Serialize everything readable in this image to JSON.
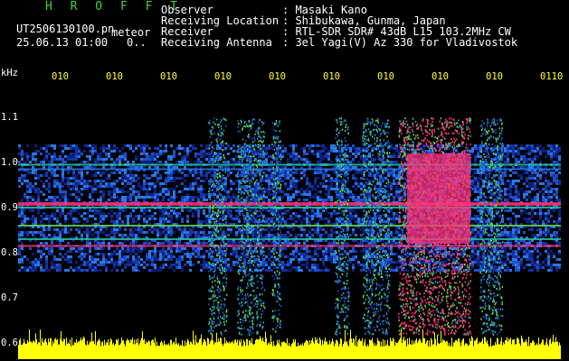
{
  "header": {
    "title": "H R O F F T",
    "filename": "UT2506130100.pn",
    "tag": "meteor",
    "timestamp": "25.06.13 01:00",
    "timestamp_extra": "0..",
    "fields": [
      {
        "label": "Observer",
        "value": ": Masaki Kano"
      },
      {
        "label": "Receiving Location",
        "value": ": Shibukawa, Gunma, Japan"
      },
      {
        "label": "Receiver",
        "value": ": RTL-SDR SDR# 43dB L15 103.2MHz CW"
      },
      {
        "label": "Receiving Antenna",
        "value": ": 3el Yagi(V) Az 330 for Vladivostok"
      }
    ]
  },
  "chart_data": {
    "type": "heatmap",
    "ylabel": "kHz",
    "yticks": [
      "1.1",
      "1.0",
      "0.9",
      "0.8",
      "0.7",
      "0.6"
    ],
    "xticks": [
      "010",
      "010",
      "010",
      "010",
      "010",
      "010",
      "010",
      "010",
      "010",
      "0110"
    ],
    "ylim": [
      0.6,
      1.1
    ],
    "colors": {
      "background": "#000000",
      "signal_low": "#1e50c8",
      "signal_mid": "#23c8a0",
      "signal_high": "#ff3278",
      "bottom_band": "#ffff00"
    }
  }
}
